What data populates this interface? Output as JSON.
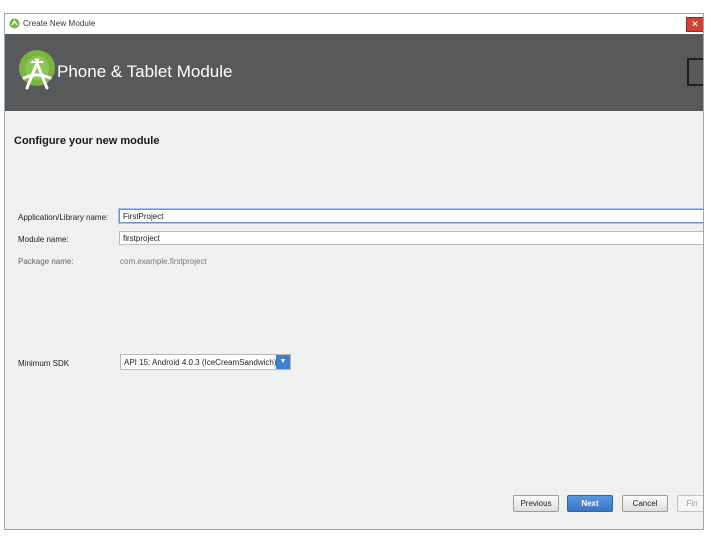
{
  "window": {
    "title": "Create New Module",
    "close_glyph": "✕"
  },
  "banner": {
    "title": "Phone & Tablet Module",
    "logo_icon": "android-studio-logo-icon"
  },
  "form": {
    "heading": "Configure your new module",
    "app_name_label": "Application/Library name:",
    "app_name_value": "FirstProject",
    "module_name_label": "Module name:",
    "module_name_value": "firstproject",
    "package_name_label": "Package name:",
    "package_name_value": "com.example.firstproject",
    "min_sdk_label": "Minimum SDK",
    "min_sdk_value": "API 15: Android 4.0.3 (IceCreamSandwich)"
  },
  "buttons": {
    "previous": "Previous",
    "next": "Next",
    "cancel": "Cancel",
    "finish": "Fin"
  },
  "colors": {
    "banner_bg": "#57595b",
    "accent": "#3f7fd0",
    "android_green": "#7cb342"
  }
}
